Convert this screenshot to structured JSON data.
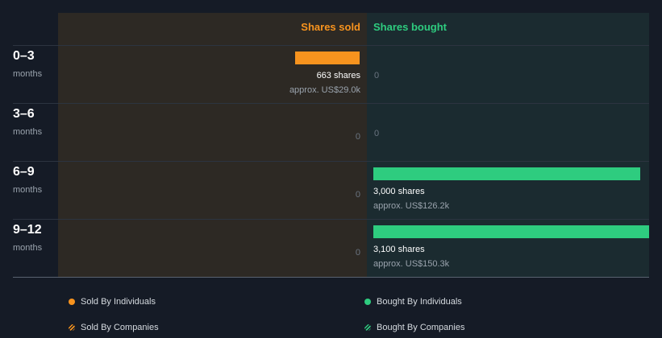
{
  "chart_data": {
    "type": "bar",
    "headers": {
      "sold": "Shares sold",
      "bought": "Shares bought"
    },
    "periods": [
      {
        "label": "0–3",
        "unit": "months",
        "sold": {
          "shares": 663,
          "shares_text": "663 shares",
          "approx_text": "approx. US$29.0k"
        },
        "bought": {
          "shares": 0,
          "zero_text": "0"
        }
      },
      {
        "label": "3–6",
        "unit": "months",
        "sold": {
          "shares": 0,
          "zero_text": "0"
        },
        "bought": {
          "shares": 0,
          "zero_text": "0"
        }
      },
      {
        "label": "6–9",
        "unit": "months",
        "sold": {
          "shares": 0,
          "zero_text": "0"
        },
        "bought": {
          "shares": 3000,
          "shares_text": "3,000 shares",
          "approx_text": "approx. US$126.2k"
        }
      },
      {
        "label": "9–12",
        "unit": "months",
        "sold": {
          "shares": 0,
          "zero_text": "0"
        },
        "bought": {
          "shares": 3100,
          "shares_text": "3,100 shares",
          "approx_text": "approx. US$150.3k"
        }
      }
    ],
    "max_shares": 3100,
    "legend": [
      {
        "label": "Sold By Individuals",
        "color": "#f7931e",
        "style": "solid"
      },
      {
        "label": "Bought By Individuals",
        "color": "#2ecc7f",
        "style": "solid"
      },
      {
        "label": "Sold By Companies",
        "color": "#f7931e",
        "style": "hatched"
      },
      {
        "label": "Bought By Companies",
        "color": "#2ecc7f",
        "style": "hatched"
      }
    ],
    "colors": {
      "sold": "#f7931e",
      "bought": "#2ecc7f"
    }
  }
}
